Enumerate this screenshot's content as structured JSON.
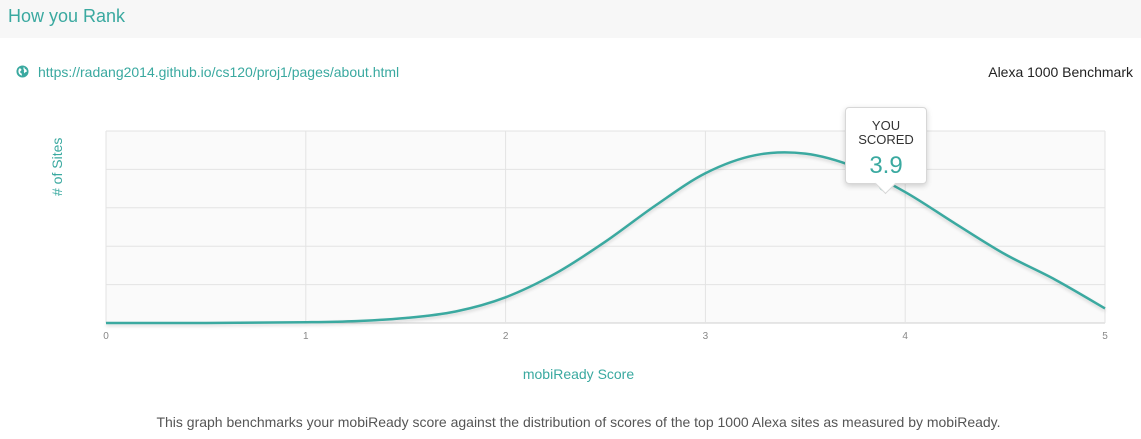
{
  "header": {
    "title": "How you Rank"
  },
  "site": {
    "url": "https://radang2014.github.io/cs120/proj1/pages/about.html",
    "icon": "globe-icon"
  },
  "benchmark_label": "Alexa 1000 Benchmark",
  "tooltip": {
    "line1": "YOU",
    "line2": "SCORED",
    "score": "3.9"
  },
  "footer": "This graph benchmarks your mobiReady score against the distribution of scores of the top 1000 Alexa sites as measured by mobiReady.",
  "colors": {
    "accent": "#3aa9a0",
    "grid": "#e3e3e3",
    "plot_bg": "#fafafa"
  },
  "chart_data": {
    "type": "area",
    "xlabel": "mobiReady Score",
    "ylabel": "# of Sites",
    "xlim": [
      0,
      5
    ],
    "ylim": [
      0,
      5
    ],
    "x_ticks": [
      "0",
      "1",
      "2",
      "3",
      "4",
      "5"
    ],
    "grid": true,
    "series": [
      {
        "x": [
          0,
          0.25,
          0.5,
          0.75,
          1,
          1.25,
          1.5,
          1.75,
          2,
          2.25,
          2.5,
          2.75,
          3,
          3.25,
          3.5,
          3.75,
          4,
          4.25,
          4.5,
          4.75,
          5
        ],
        "y": [
          0,
          0,
          0,
          0.01,
          0.02,
          0.05,
          0.13,
          0.3,
          0.67,
          1.29,
          2.12,
          3.06,
          3.9,
          4.37,
          4.41,
          4.06,
          3.41,
          2.59,
          1.79,
          1.13,
          0.38
        ]
      }
    ],
    "marker": {
      "x": 3.9,
      "y": 3.6,
      "label": "3.9"
    }
  }
}
